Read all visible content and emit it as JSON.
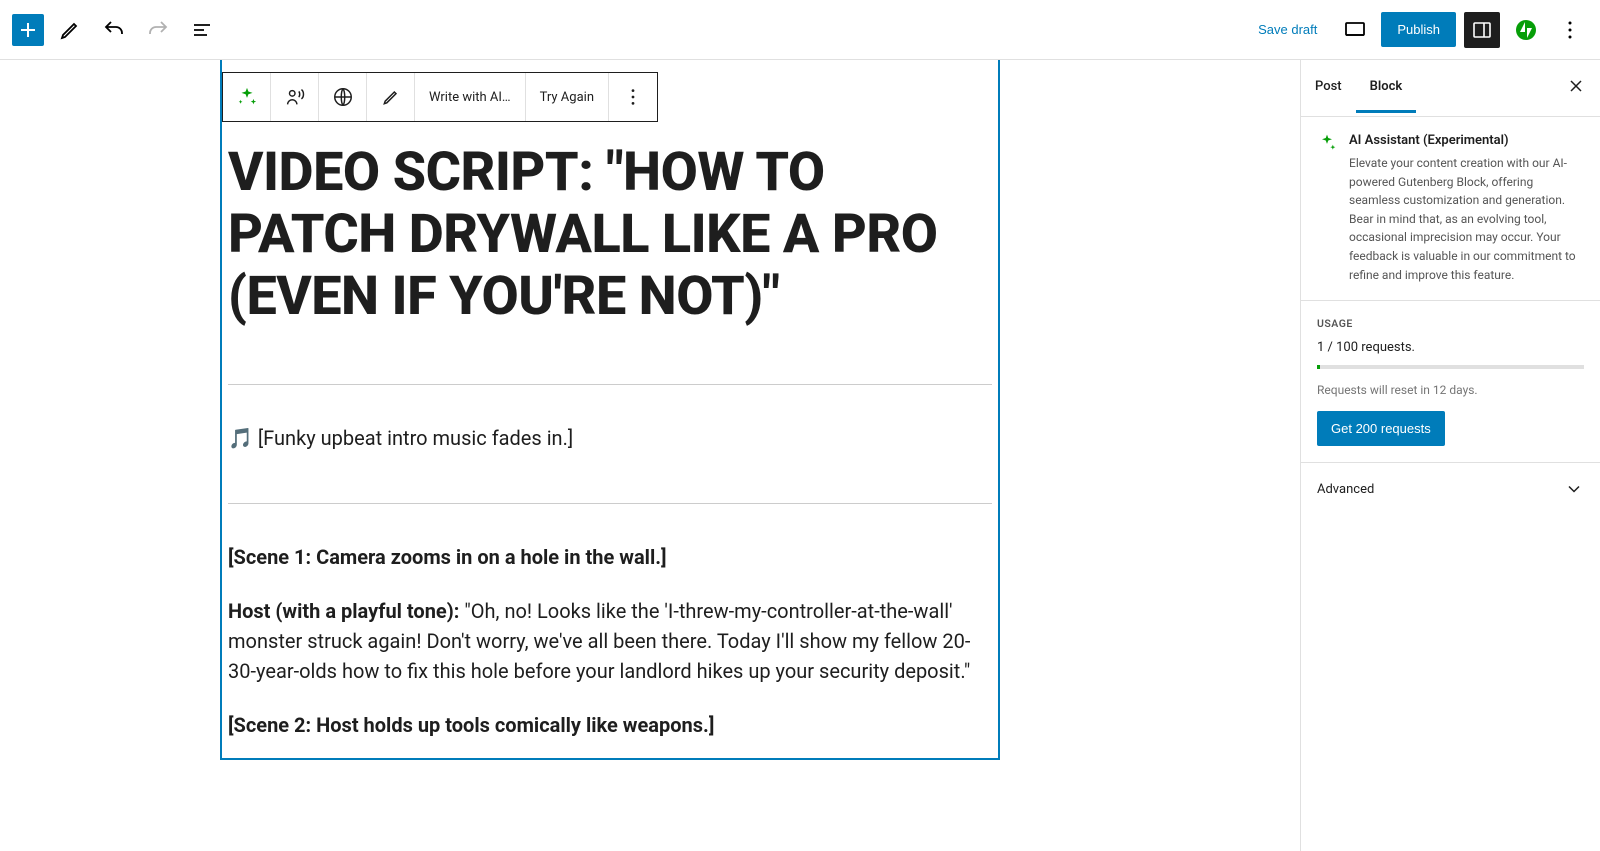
{
  "toolbar": {
    "save_draft": "Save draft",
    "publish": "Publish"
  },
  "block_toolbar": {
    "write_ai": "Write with AI…",
    "try_again": "Try Again"
  },
  "content": {
    "title": "VIDEO SCRIPT: \"HOW TO PATCH DRYWALL LIKE A PRO (EVEN IF YOU'RE NOT)\"",
    "intro_music": "🎵 [Funky upbeat intro music fades in.]",
    "scene1_heading": "[Scene 1: Camera zooms in on a hole in the wall.]",
    "host_label": "Host (with a playful tone): ",
    "host_line1": "\"Oh, no! Looks like the 'I-threw-my-controller-at-the-wall' monster struck again! Don't worry, we've all been there. Today I'll show my fellow 20-30-year-olds how to fix this hole before your landlord hikes up your security deposit.\"",
    "scene2_heading": "[Scene 2: Host holds up tools comically like weapons.]"
  },
  "sidebar": {
    "tabs": {
      "post": "Post",
      "block": "Block"
    },
    "ai_title": "AI Assistant (Experimental)",
    "ai_desc": "Elevate your content creation with our AI-powered Gutenberg Block, offering seamless customization and generation. Bear in mind that, as an evolving tool, occasional imprecision may occur. Your feedback is valuable in our commitment to refine and improve this feature.",
    "usage_label": "USAGE",
    "usage_text": "1 / 100 requests.",
    "reset_text": "Requests will reset in 12 days.",
    "get_requests": "Get 200 requests",
    "advanced": "Advanced"
  }
}
